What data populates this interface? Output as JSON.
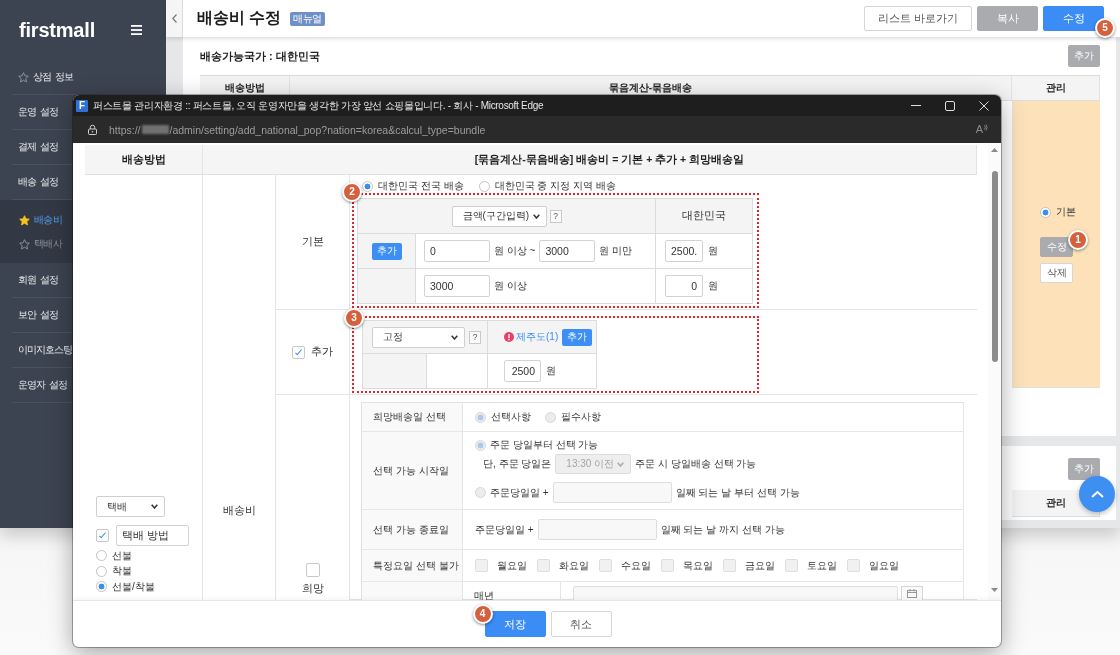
{
  "sidebar": {
    "logo": "firstmall",
    "items": [
      {
        "label": "상점 정보",
        "kind": "favorite"
      },
      {
        "label": "운영 설정",
        "kind": "menu"
      },
      {
        "label": "결제 설정",
        "kind": "menu"
      },
      {
        "label": "배송 설정",
        "kind": "menu",
        "children": [
          {
            "label": "배송비",
            "selected": true
          },
          {
            "label": "택배사",
            "selected": false
          }
        ]
      },
      {
        "label": "회원 설정",
        "kind": "menu"
      },
      {
        "label": "보안 설정",
        "kind": "menu"
      },
      {
        "label": "이미지호스팅",
        "kind": "menu"
      },
      {
        "label": "운영자 설정",
        "kind": "menu"
      }
    ]
  },
  "header": {
    "title": "배송비 수정",
    "badge": "매뉴얼",
    "buttons": [
      {
        "label": "리스트 바로가기",
        "kind": "outline"
      },
      {
        "label": "복사",
        "kind": "secondary"
      },
      {
        "label": "수정",
        "kind": "primary",
        "marker": "5"
      }
    ]
  },
  "shipping_panel": {
    "title": "배송가능국가 : 대한민국",
    "add_button": "추가",
    "columns": [
      "배송방법",
      "묶음계산-묶음배송",
      "관리"
    ],
    "manage": {
      "option": {
        "label": "기본",
        "selected": true
      },
      "buttons": [
        {
          "label": "수정",
          "kind": "secondary",
          "marker": "1"
        },
        {
          "label": "삭제",
          "kind": "outline"
        }
      ]
    }
  },
  "second_panel": {
    "add_button": "추가",
    "manage_column": "관리"
  },
  "popup": {
    "favicon": "F",
    "title": "퍼스트몰 관리자환경 :: 퍼스트몰, 오직 운영자만을 생각한 가장 앞선 쇼핑몰입니다. - 회사 - Microsoft Edge",
    "url_scheme": "https://",
    "url_path": "/admin/setting/add_national_pop?nation=korea&calcul_type=bundle",
    "read_aloud": "A",
    "columns": [
      "배송방법",
      "[묶음계산-묶음배송] 배송비 = 기본 + 추가 + 희망배송일"
    ],
    "method": {
      "select": "택배",
      "named": {
        "checked": true,
        "value": "택배 방법"
      },
      "payment": [
        {
          "label": "선불",
          "selected": false
        },
        {
          "label": "착불",
          "selected": false
        },
        {
          "label": "선불/착불",
          "selected": true
        }
      ]
    },
    "fee_label": "배송비",
    "basic": {
      "label": "기본",
      "scope": [
        {
          "label": "대한민국 전국 배송",
          "selected": true
        },
        {
          "label": "대한민국 중 지정 지역 배송",
          "selected": false
        }
      ],
      "marker": "2",
      "type_select": "금액(구간입력)",
      "help": "?",
      "region": "대한민국",
      "ranges": [
        {
          "kind": "between",
          "add_button": "추가",
          "from": "0",
          "from_unit": "원 이상 ~",
          "to": "3000",
          "to_unit": "원 미만",
          "fee": "2500.",
          "fee_unit": "원"
        },
        {
          "kind": "above",
          "from": "3000",
          "from_unit": "원 이상",
          "fee": "0",
          "fee_unit": "원"
        }
      ]
    },
    "extra": {
      "label": "추가",
      "checked": true,
      "marker": "3",
      "type_select": "고정",
      "help": "?",
      "region_link": "제주도(1)",
      "add_button": "추가",
      "fee": "2500",
      "fee_unit": "원"
    },
    "hope": {
      "label": "희망",
      "checked": false,
      "choice": {
        "label": "희망배송일 선택",
        "options": [
          {
            "label": "선택사항",
            "selected": true
          },
          {
            "label": "필수사항",
            "selected": false
          }
        ]
      },
      "start": {
        "label": "선택 가능 시작일",
        "same_day": {
          "label": "주문 당일부터 선택 가능",
          "selected": true
        },
        "note_prefix": "단, 주문 당일은",
        "cutoff": "13:30 이전",
        "note_suffix": "주문 시 당일배송 선택 가능",
        "offset": {
          "label": "주문당일일 +",
          "selected": false
        },
        "offset_suffix": "일째 되는 날 부터 선택 가능"
      },
      "end": {
        "label": "선택 가능 종료일",
        "prefix": "주문당일일 +",
        "suffix": "일째 되는 날 까지 선택 가능"
      },
      "blocked": {
        "label": "특정요일 선택 불가",
        "days": [
          {
            "label": "월요일",
            "checked": false
          },
          {
            "label": "화요일",
            "checked": false
          },
          {
            "label": "수요일",
            "checked": false
          },
          {
            "label": "목요일",
            "checked": false
          },
          {
            "label": "금요일",
            "checked": false
          },
          {
            "label": "토요일",
            "checked": false
          },
          {
            "label": "일요일",
            "checked": false
          }
        ]
      },
      "yearly": {
        "label": "매년"
      }
    },
    "buttons": [
      {
        "label": "저장",
        "kind": "primary",
        "marker": "4"
      },
      {
        "label": "취소",
        "kind": "outline"
      }
    ]
  }
}
